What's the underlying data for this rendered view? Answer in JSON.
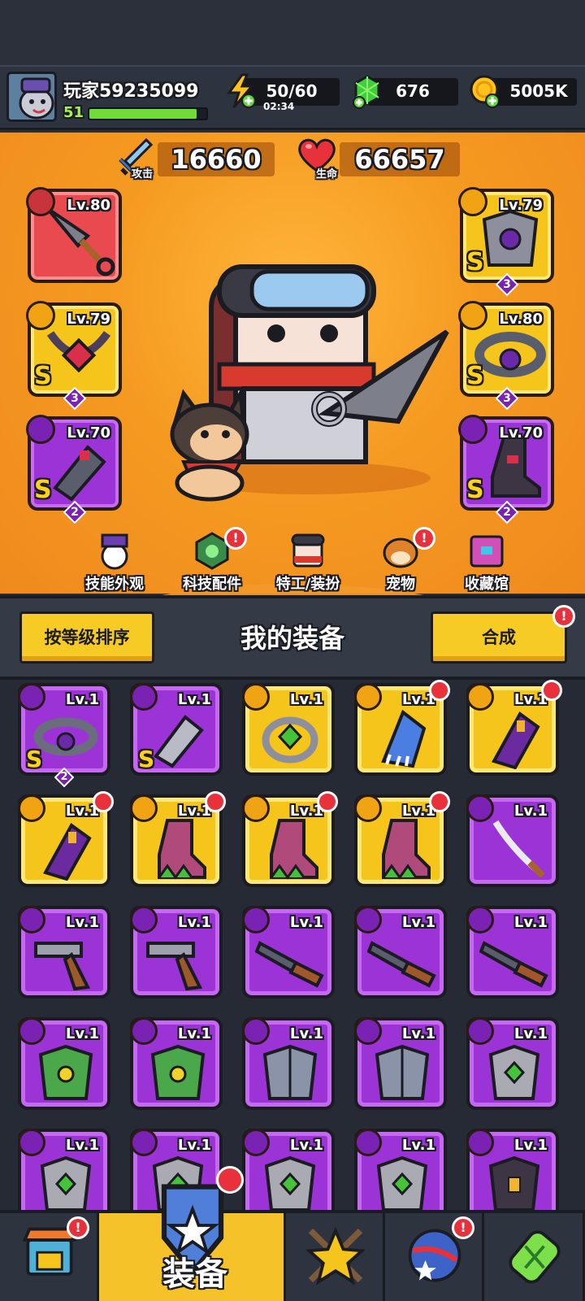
{
  "player": {
    "name": "玩家59235099",
    "level": "51",
    "xp_fraction": 0.92
  },
  "resources": {
    "energy": {
      "value": "50/60",
      "timer": "02:34"
    },
    "gems": {
      "value": "676"
    },
    "gold": {
      "value": "5005K"
    }
  },
  "stats": {
    "attack": {
      "label": "攻击",
      "value": "16660"
    },
    "hp": {
      "label": "生命",
      "value": "66657"
    }
  },
  "equipped": {
    "weapon": {
      "level": "Lv.80",
      "rarity": "red"
    },
    "necklace": {
      "level": "Lv.79",
      "grade": "S",
      "stars": "3",
      "rarity": "yellow"
    },
    "gloves": {
      "level": "Lv.70",
      "grade": "S",
      "stars": "2",
      "rarity": "purple"
    },
    "armor": {
      "level": "Lv.79",
      "grade": "S",
      "stars": "3",
      "rarity": "yellow"
    },
    "belt": {
      "level": "Lv.80",
      "grade": "S",
      "stars": "3",
      "rarity": "yellow"
    },
    "boots": {
      "level": "Lv.70",
      "grade": "S",
      "stars": "2",
      "rarity": "purple"
    }
  },
  "menu": [
    {
      "label": "技能外观",
      "icon": "hat-ball-icon",
      "alert": false
    },
    {
      "label": "科技配件",
      "icon": "tech-chip-icon",
      "alert": true
    },
    {
      "label": "特工/装扮",
      "icon": "agent-head-icon",
      "alert": false
    },
    {
      "label": "宠物",
      "icon": "pet-dog-icon",
      "alert": true
    },
    {
      "label": "收藏馆",
      "icon": "collection-chest-icon",
      "alert": false
    }
  ],
  "panel": {
    "title": "我的装备",
    "sort_label": "按等级排序",
    "merge_label": "合成",
    "merge_alert": "!"
  },
  "alert_mark": "!",
  "inventory": [
    {
      "level": "Lv.1",
      "rarity": "purple",
      "kind": "belt",
      "grade": "S",
      "stars": "2",
      "new": false
    },
    {
      "level": "Lv.1",
      "rarity": "purple",
      "kind": "gloves",
      "grade": "S",
      "stars": "",
      "new": false
    },
    {
      "level": "Lv.1",
      "rarity": "yellow",
      "kind": "ring",
      "grade": "",
      "stars": "",
      "new": false
    },
    {
      "level": "Lv.1",
      "rarity": "yellow",
      "kind": "claw",
      "grade": "",
      "stars": "",
      "new": true
    },
    {
      "level": "Lv.1",
      "rarity": "yellow",
      "kind": "gauntlet",
      "grade": "",
      "stars": "",
      "new": true
    },
    {
      "level": "Lv.1",
      "rarity": "yellow",
      "kind": "gauntlet",
      "grade": "",
      "stars": "",
      "new": true
    },
    {
      "level": "Lv.1",
      "rarity": "yellow",
      "kind": "boot",
      "grade": "",
      "stars": "",
      "new": true
    },
    {
      "level": "Lv.1",
      "rarity": "yellow",
      "kind": "boot",
      "grade": "",
      "stars": "",
      "new": true
    },
    {
      "level": "Lv.1",
      "rarity": "yellow",
      "kind": "boot",
      "grade": "",
      "stars": "",
      "new": true
    },
    {
      "level": "Lv.1",
      "rarity": "purple",
      "kind": "sword",
      "grade": "",
      "stars": "",
      "new": false
    },
    {
      "level": "Lv.1",
      "rarity": "purple",
      "kind": "revolver",
      "grade": "",
      "stars": "",
      "new": false
    },
    {
      "level": "Lv.1",
      "rarity": "purple",
      "kind": "revolver",
      "grade": "",
      "stars": "",
      "new": false
    },
    {
      "level": "Lv.1",
      "rarity": "purple",
      "kind": "shotgun",
      "grade": "",
      "stars": "",
      "new": false
    },
    {
      "level": "Lv.1",
      "rarity": "purple",
      "kind": "shotgun",
      "grade": "",
      "stars": "",
      "new": false
    },
    {
      "level": "Lv.1",
      "rarity": "purple",
      "kind": "shotgun",
      "grade": "",
      "stars": "",
      "new": false
    },
    {
      "level": "Lv.1",
      "rarity": "purple",
      "kind": "green-armor",
      "grade": "",
      "stars": "",
      "new": false
    },
    {
      "level": "Lv.1",
      "rarity": "purple",
      "kind": "green-armor",
      "grade": "",
      "stars": "",
      "new": false
    },
    {
      "level": "Lv.1",
      "rarity": "purple",
      "kind": "steel-armor",
      "grade": "",
      "stars": "",
      "new": false
    },
    {
      "level": "Lv.1",
      "rarity": "purple",
      "kind": "steel-armor",
      "grade": "",
      "stars": "",
      "new": false
    },
    {
      "level": "Lv.1",
      "rarity": "purple",
      "kind": "gray-armor",
      "grade": "",
      "stars": "",
      "new": false
    },
    {
      "level": "Lv.1",
      "rarity": "purple",
      "kind": "gray-armor",
      "grade": "",
      "stars": "",
      "new": false
    },
    {
      "level": "Lv.1",
      "rarity": "purple",
      "kind": "gray-armor",
      "grade": "",
      "stars": "",
      "new": false
    },
    {
      "level": "Lv.1",
      "rarity": "purple",
      "kind": "gray-armor",
      "grade": "",
      "stars": "",
      "new": false
    },
    {
      "level": "Lv.1",
      "rarity": "purple",
      "kind": "gray-armor",
      "grade": "",
      "stars": "",
      "new": false
    },
    {
      "level": "Lv.1",
      "rarity": "purple",
      "kind": "dark-armor",
      "grade": "",
      "stars": "",
      "new": false
    }
  ],
  "bottom_nav": [
    {
      "label": "",
      "icon": "shop-icon",
      "alert": true
    },
    {
      "label": "装备",
      "icon": "equipment-icon",
      "alert": true,
      "active": true
    },
    {
      "label": "",
      "icon": "battle-star-icon",
      "alert": false
    },
    {
      "label": "",
      "icon": "planet-icon",
      "alert": true
    },
    {
      "label": "",
      "icon": "dna-capsule-icon",
      "alert": false
    }
  ],
  "colors": {
    "accent_yellow": "#f6c51c",
    "epic_purple": "#9b33d6",
    "legend_red": "#e84a4f",
    "alert_red": "#e8313a",
    "hero_orange": "#f59a21"
  }
}
